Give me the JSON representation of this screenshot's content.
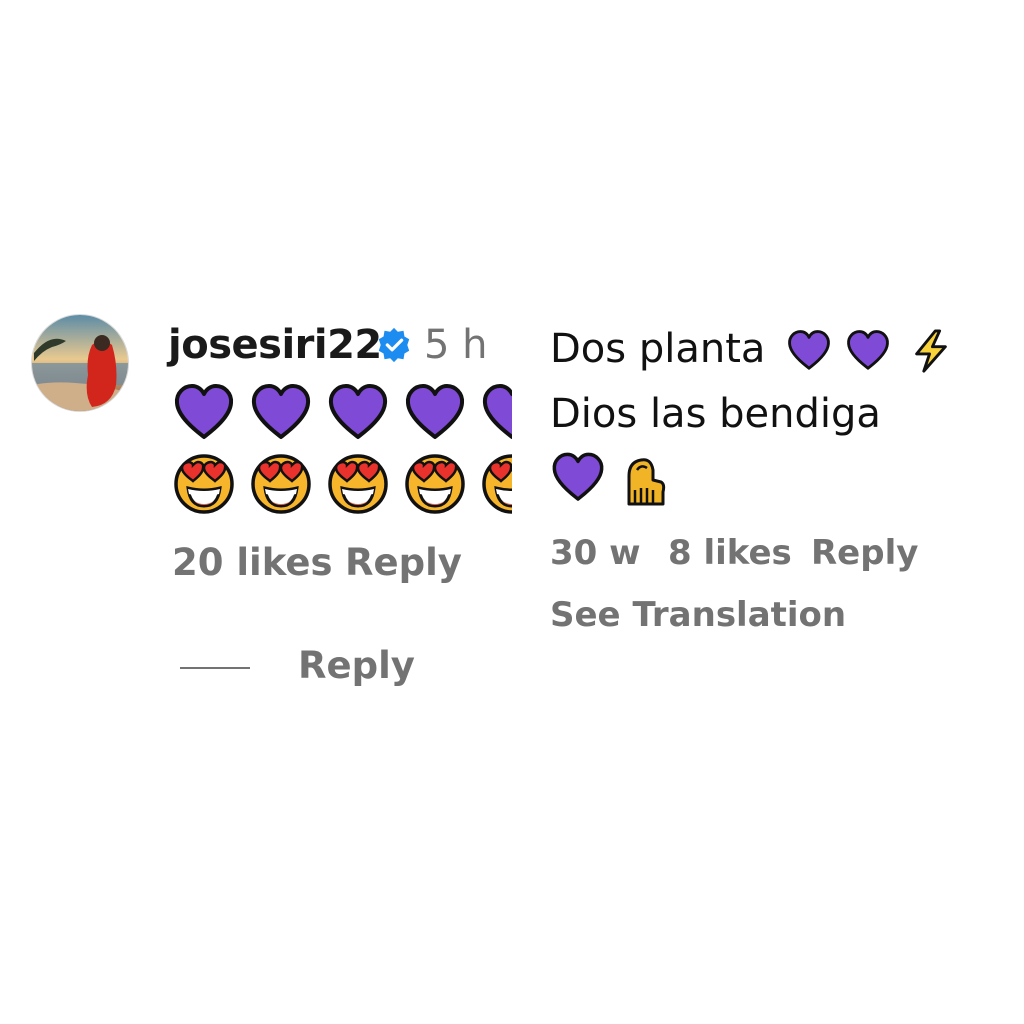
{
  "comment_left": {
    "username": "josesiri22",
    "time": "5 h",
    "emoji_rows": [
      "purple-heart",
      "heart-eyes-face"
    ],
    "likes": "20 likes",
    "reply_label": "Reply",
    "thread_reply_label": "Reply"
  },
  "comment_right": {
    "line1": "Dos planta",
    "line2": "Dios las bendiga",
    "time": "30 w",
    "likes": "8 likes",
    "reply_label": "Reply",
    "see_translation": "See Translation"
  },
  "colors": {
    "purple_heart": "#7f4bd6",
    "meta_gray": "#737373",
    "verified_blue": "#1d8cf0"
  }
}
